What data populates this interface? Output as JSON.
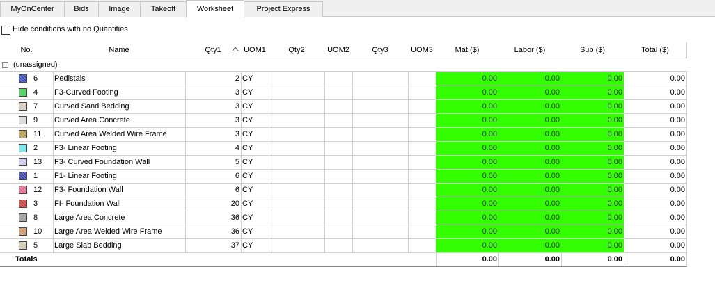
{
  "tabs": [
    {
      "label": "MyOnCenter",
      "active": false
    },
    {
      "label": "Bids",
      "active": false
    },
    {
      "label": "Image",
      "active": false
    },
    {
      "label": "Takeoff",
      "active": false
    },
    {
      "label": "Worksheet",
      "active": true
    },
    {
      "label": "Project Express",
      "active": false
    }
  ],
  "toolbar": {
    "hide_conditions_label": "Hide conditions with no Quantities",
    "hide_conditions_checked": false
  },
  "columns": [
    "No.",
    "Name",
    "Qty1",
    "UOM1",
    "Qty2",
    "UOM2",
    "Qty3",
    "UOM3",
    "Mat.($)",
    "Labor ($)",
    "Sub ($)",
    "Total ($)"
  ],
  "group": {
    "label": "(unassigned)",
    "expanded": true
  },
  "colors": {
    "cost_fill": "#33ff00"
  },
  "rows": [
    {
      "no": "6",
      "name": "Pedistals",
      "qty1": "2",
      "uom1": "CY",
      "mat": "0.00",
      "labor": "0.00",
      "sub": "0.00",
      "total": "0.00",
      "swatch": "#3c4fb8",
      "pattern": "cross"
    },
    {
      "no": "4",
      "name": "F3-Curved Footing",
      "qty1": "3",
      "uom1": "CY",
      "mat": "0.00",
      "labor": "0.00",
      "sub": "0.00",
      "total": "0.00",
      "swatch": "#5ad36a",
      "pattern": "solid"
    },
    {
      "no": "7",
      "name": "Curved Sand Bedding",
      "qty1": "3",
      "uom1": "CY",
      "mat": "0.00",
      "labor": "0.00",
      "sub": "0.00",
      "total": "0.00",
      "swatch": "#d8d0c4",
      "pattern": "solid"
    },
    {
      "no": "9",
      "name": "Curved Area Concrete",
      "qty1": "3",
      "uom1": "CY",
      "mat": "0.00",
      "labor": "0.00",
      "sub": "0.00",
      "total": "0.00",
      "swatch": "#dcdcdc",
      "pattern": "solid"
    },
    {
      "no": "11",
      "name": "Curved Area Welded Wire Frame",
      "qty1": "3",
      "uom1": "CY",
      "mat": "0.00",
      "labor": "0.00",
      "sub": "0.00",
      "total": "0.00",
      "swatch": "#b09a50",
      "pattern": "cross"
    },
    {
      "no": "2",
      "name": "F3- Linear Footing",
      "qty1": "4",
      "uom1": "CY",
      "mat": "0.00",
      "labor": "0.00",
      "sub": "0.00",
      "total": "0.00",
      "swatch": "#7fe8ee",
      "pattern": "solid"
    },
    {
      "no": "13",
      "name": "F3- Curved Foundation Wall",
      "qty1": "5",
      "uom1": "CY",
      "mat": "0.00",
      "labor": "0.00",
      "sub": "0.00",
      "total": "0.00",
      "swatch": "#c8c8e6",
      "pattern": "cross"
    },
    {
      "no": "1",
      "name": "F1- Linear Footing",
      "qty1": "6",
      "uom1": "CY",
      "mat": "0.00",
      "labor": "0.00",
      "sub": "0.00",
      "total": "0.00",
      "swatch": "#3a40a8",
      "pattern": "cross"
    },
    {
      "no": "12",
      "name": "F3- Foundation Wall",
      "qty1": "6",
      "uom1": "CY",
      "mat": "0.00",
      "labor": "0.00",
      "sub": "0.00",
      "total": "0.00",
      "swatch": "#e06a8c",
      "pattern": "cross"
    },
    {
      "no": "3",
      "name": "FI- Foundation Wall",
      "qty1": "20",
      "uom1": "CY",
      "mat": "0.00",
      "labor": "0.00",
      "sub": "0.00",
      "total": "0.00",
      "swatch": "#c8403a",
      "pattern": "cross"
    },
    {
      "no": "8",
      "name": "Large Area Concrete",
      "qty1": "36",
      "uom1": "CY",
      "mat": "0.00",
      "labor": "0.00",
      "sub": "0.00",
      "total": "0.00",
      "swatch": "#a8a8a8",
      "pattern": "solid"
    },
    {
      "no": "10",
      "name": "Large Area Welded Wire Frame",
      "qty1": "36",
      "uom1": "CY",
      "mat": "0.00",
      "labor": "0.00",
      "sub": "0.00",
      "total": "0.00",
      "swatch": "#c8966a",
      "pattern": "cross"
    },
    {
      "no": "5",
      "name": "Large Slab Bedding",
      "qty1": "37",
      "uom1": "CY",
      "mat": "0.00",
      "labor": "0.00",
      "sub": "0.00",
      "total": "0.00",
      "swatch": "#d4d0bc",
      "pattern": "solid"
    }
  ],
  "totals": {
    "label": "Totals",
    "mat": "0.00",
    "labor": "0.00",
    "sub": "0.00",
    "total": "0.00"
  }
}
